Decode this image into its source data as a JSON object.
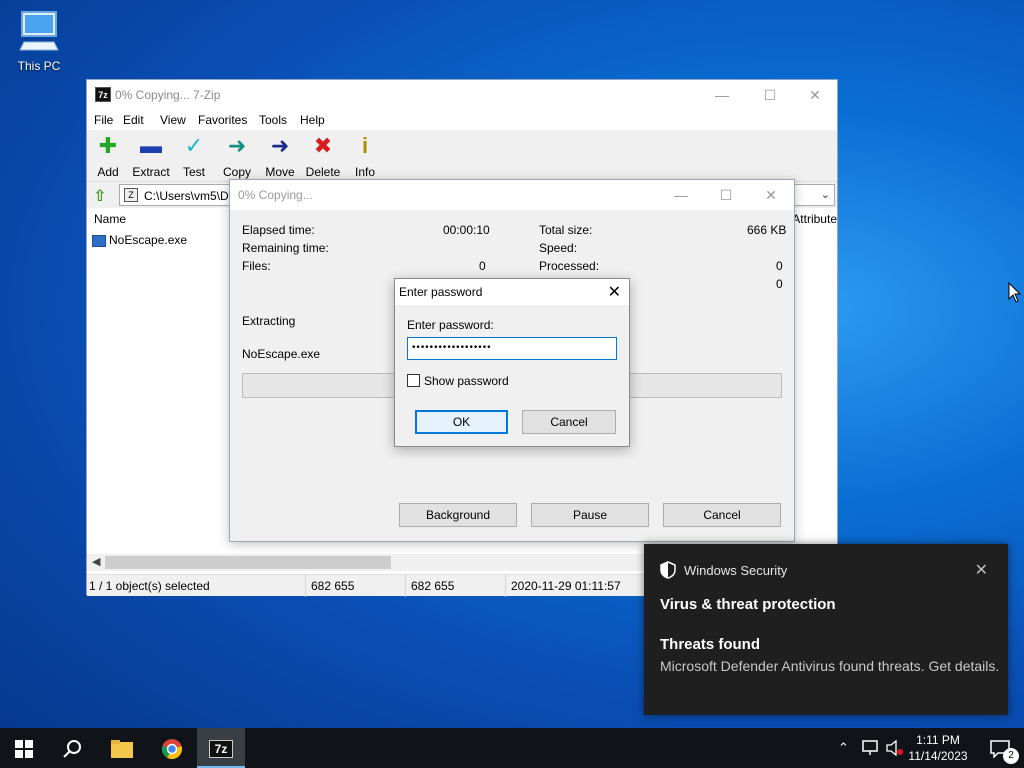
{
  "desktop": {
    "icon_label": "This PC"
  },
  "main_window": {
    "title": "0% Copying... 7-Zip",
    "menu": [
      "File",
      "Edit",
      "View",
      "Favorites",
      "Tools",
      "Help"
    ],
    "toolbar": [
      "Add",
      "Extract",
      "Test",
      "Copy",
      "Move",
      "Delete",
      "Info"
    ],
    "address": "C:\\Users\\vm5\\De",
    "columns": {
      "name": "Name",
      "attributes": "Attribute"
    },
    "files": [
      {
        "name": "NoEscape.exe"
      }
    ],
    "status": {
      "selected": "1 / 1 object(s) selected",
      "size": "682 655",
      "packed": "682 655",
      "modified": "2020-11-29 01:11:57"
    }
  },
  "progress_dialog": {
    "title": "0% Copying...",
    "elapsed_label": "Elapsed time:",
    "elapsed_value": "00:00:10",
    "remaining_label": "Remaining time:",
    "files_label": "Files:",
    "files_value": "0",
    "total_label": "Total size:",
    "total_value": "666 KB",
    "speed_label": "Speed:",
    "processed_label": "Processed:",
    "processed_value": "0",
    "compressed_value": "0",
    "action": "Extracting",
    "current_file": "NoEscape.exe",
    "buttons": {
      "background": "Background",
      "pause": "Pause",
      "cancel": "Cancel"
    }
  },
  "password_dialog": {
    "title": "Enter password",
    "field_label": "Enter password:",
    "field_value": "••••••••••••••••••",
    "show_password": "Show password",
    "ok": "OK",
    "cancel": "Cancel"
  },
  "toast": {
    "app": "Windows Security",
    "heading": "Virus & threat protection",
    "subheading": "Threats found",
    "body": "Microsoft Defender Antivirus found threats. Get details."
  },
  "taskbar": {
    "time": "1:11 PM",
    "date": "11/14/2023",
    "notification_count": "2",
    "app_7zip_label": "7z"
  }
}
